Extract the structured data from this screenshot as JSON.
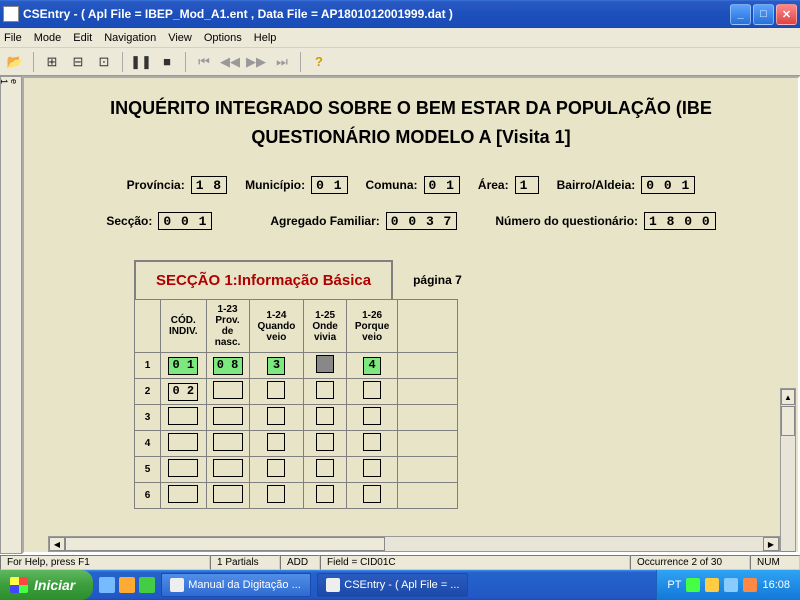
{
  "titlebar": {
    "text": "CSEntry - ( Apl File = IBEP_Mod_A1.ent , Data File = AP1801012001999.dat )"
  },
  "menubar": [
    "File",
    "Mode",
    "Edit",
    "Navigation",
    "View",
    "Options",
    "Help"
  ],
  "page": {
    "title": "INQUÉRITO INTEGRADO SOBRE O BEM ESTAR DA POPULAÇÃO (IBE",
    "subtitle": "QUESTIONÁRIO MODELO A  [Visita 1]"
  },
  "fields_row1": {
    "provincia": {
      "label": "Província:",
      "value": "1 8"
    },
    "municipio": {
      "label": "Município:",
      "value": "0 1"
    },
    "comuna": {
      "label": "Comuna:",
      "value": "0 1"
    },
    "area": {
      "label": "Área:",
      "value": "1"
    },
    "bairro": {
      "label": "Bairro/Aldeia:",
      "value": "0 0 1"
    }
  },
  "fields_row2": {
    "seccao": {
      "label": "Secção:",
      "value": "0 0 1"
    },
    "agregado": {
      "label": "Agregado Familiar:",
      "value": "0 0 3 7"
    },
    "numero": {
      "label": "Número do questionário:",
      "value": "1 8 0 0 "
    }
  },
  "section": {
    "title": "SECÇÃO 1:Informação Básica",
    "page": "página 7"
  },
  "table": {
    "headers": [
      "",
      "CÓD. INDIV.",
      "1-23 Prov. de nasc.",
      "1-24 Quando veio",
      "1-25 Onde vivia",
      "1-26 Porque veio",
      ""
    ],
    "rows": [
      {
        "n": "1",
        "c1": "0 1",
        "c2": "0 8",
        "c3": "3",
        "c4": "",
        "c5": "4",
        "c1g": true,
        "c2g": true,
        "c3g": true,
        "c4d": true,
        "c5g": true
      },
      {
        "n": "2",
        "c1": "0 2",
        "c2": "",
        "c3": "",
        "c4": "",
        "c5": ""
      },
      {
        "n": "3",
        "c1": "",
        "c2": "",
        "c3": "",
        "c4": "",
        "c5": ""
      },
      {
        "n": "4",
        "c1": "",
        "c2": "",
        "c3": "",
        "c4": "",
        "c5": ""
      },
      {
        "n": "5",
        "c1": "",
        "c2": "",
        "c3": "",
        "c4": "",
        "c5": ""
      },
      {
        "n": "6",
        "c1": "",
        "c2": "",
        "c3": "",
        "c4": "",
        "c5": ""
      }
    ]
  },
  "statusbar": {
    "help": "For Help, press F1",
    "partials": "1 Partials",
    "mode": "ADD",
    "field": "Field = CID01C",
    "occurrence": "Occurrence 2 of 30",
    "num": "NUM"
  },
  "taskbar": {
    "start": "Iniciar",
    "tasks": [
      {
        "label": "Manual da Digitação ..."
      },
      {
        "label": "CSEntry - ( Apl File = ..."
      }
    ],
    "lang": "PT",
    "clock": "16:08"
  }
}
